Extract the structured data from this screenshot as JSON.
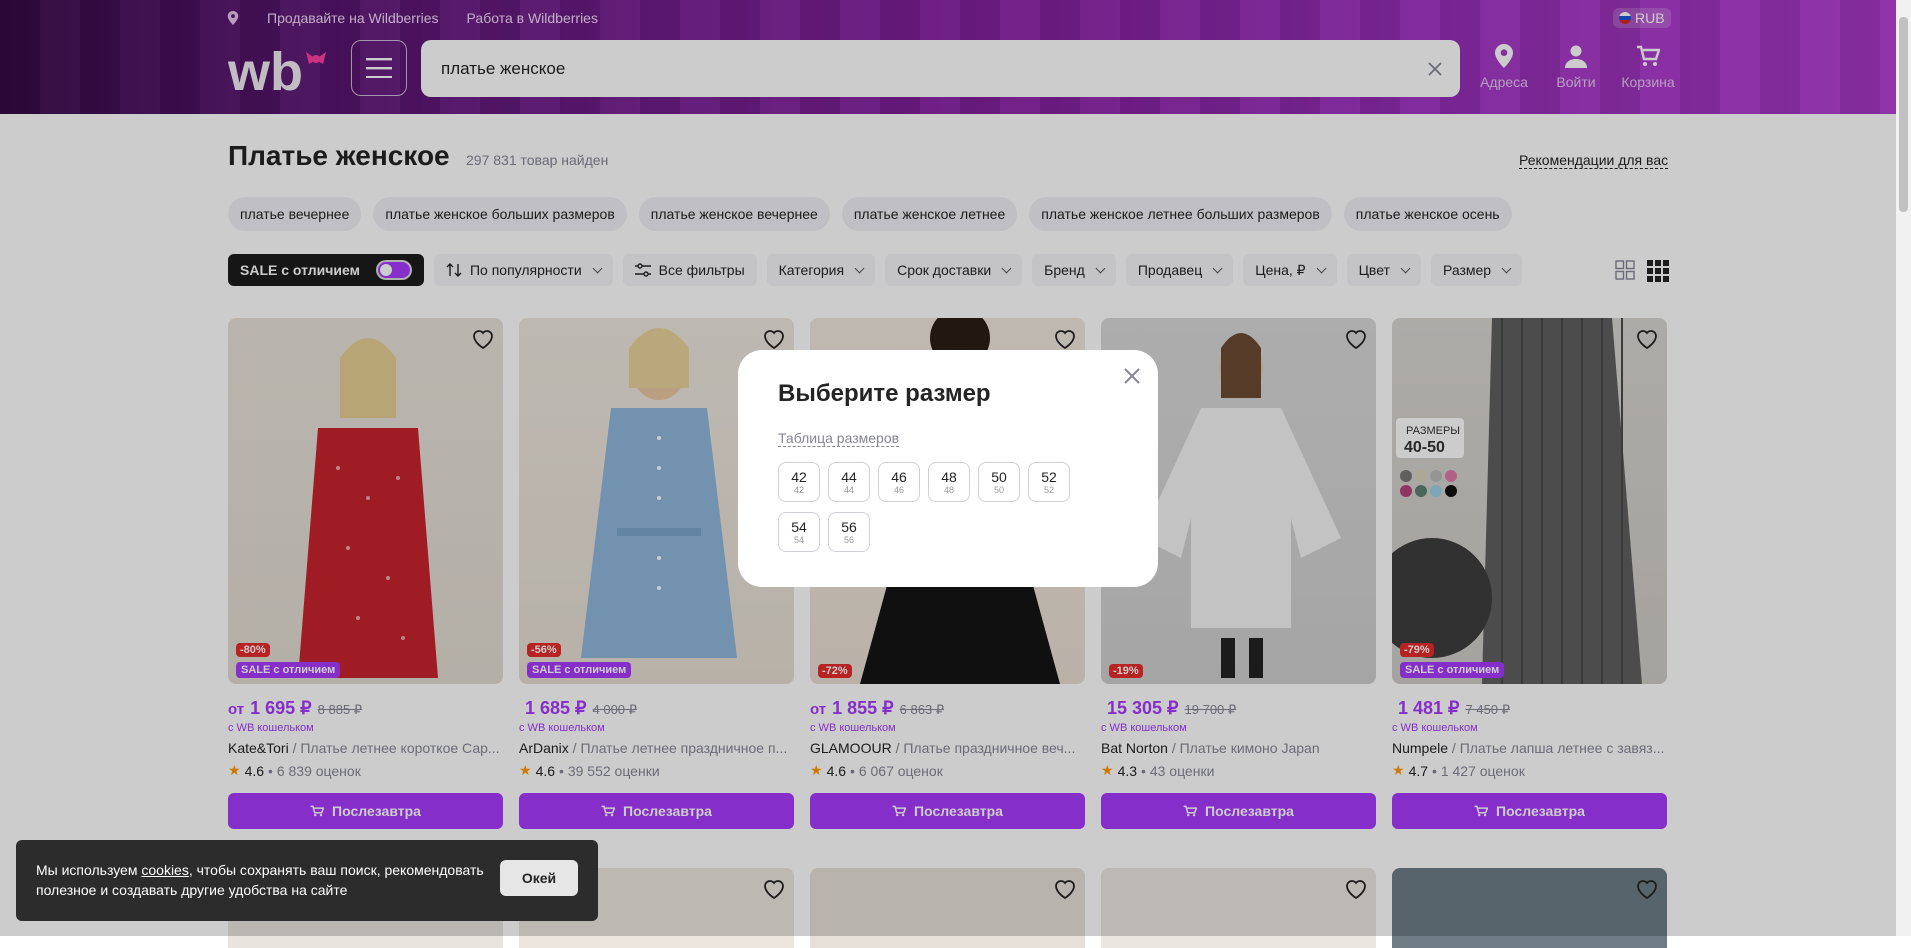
{
  "header": {
    "sell_link": "Продавайте на Wildberries",
    "work_link": "Работа в Wildberries",
    "currency": "RUB",
    "search_value": "платье женское",
    "icons": [
      {
        "icon": "location-pin-icon",
        "label": "Адреса"
      },
      {
        "icon": "user-icon",
        "label": "Войти"
      },
      {
        "icon": "cart-icon",
        "label": "Корзина"
      }
    ]
  },
  "page": {
    "title": "Платье женское",
    "count": "297 831 товар найден",
    "recommendations": "Рекомендации для вас"
  },
  "chips": [
    "платье вечернее",
    "платье женское больших размеров",
    "платье женское вечернее",
    "платье женское летнее",
    "платье женское летнее больших размеров",
    "платье женское осень"
  ],
  "filters": {
    "sale_toggle": "SALE с отличием",
    "sort": "По популярности",
    "all": "Все фильтры",
    "items": [
      "Категория",
      "Срок доставки",
      "Бренд",
      "Продавец",
      "Цена, ₽",
      "Цвет",
      "Размер"
    ]
  },
  "products": [
    {
      "from": "от",
      "price": "1 695 ₽",
      "old": "8 885 ₽",
      "wallet": "с WB кошельком",
      "brand": "Kate&Tori",
      "desc": " / Платье летнее короткое Сар...",
      "rating": "4.6",
      "reviews": "• 6 839 оценок",
      "discount": "-80%",
      "sale": "SALE с отличием",
      "buy": "Послезавтра"
    },
    {
      "from": "",
      "price": "1 685 ₽",
      "old": "4 000 ₽",
      "wallet": "с WB кошельком",
      "brand": "ArDanix",
      "desc": " / Платье летнее праздничное п...",
      "rating": "4.6",
      "reviews": "• 39 552 оценки",
      "discount": "-56%",
      "sale": "SALE с отличием",
      "buy": "Послезавтра"
    },
    {
      "from": "от",
      "price": "1 855 ₽",
      "old": "6 863 ₽",
      "wallet": "с WB кошельком",
      "brand": "GLAMOOUR",
      "desc": " / Платье праздничное веч...",
      "rating": "4.6",
      "reviews": "• 6 067 оценок",
      "discount": "-72%",
      "sale": "",
      "buy": "Послезавтра"
    },
    {
      "from": "",
      "price": "15 305 ₽",
      "old": "19 700 ₽",
      "wallet": "с WB кошельком",
      "brand": "Bat Norton",
      "desc": " / Платье кимоно Japan",
      "rating": "4.3",
      "reviews": "• 43 оценки",
      "discount": "-19%",
      "sale": "",
      "buy": "Послезавтра"
    },
    {
      "from": "",
      "price": "1 481 ₽",
      "old": "7 450 ₽",
      "wallet": "с WB кошельком",
      "brand": "Numpele",
      "desc": " / Платье лапша летнее с завяз...",
      "rating": "4.7",
      "reviews": "• 1 427 оценок",
      "discount": "-79%",
      "sale": "SALE с отличием",
      "buy": "Послезавтра"
    }
  ],
  "modal": {
    "title": "Выберите размер",
    "table_link": "Таблица размеров",
    "sizes": [
      {
        "main": "42",
        "sub": "42"
      },
      {
        "main": "44",
        "sub": "44"
      },
      {
        "main": "46",
        "sub": "46"
      },
      {
        "main": "48",
        "sub": "48"
      },
      {
        "main": "50",
        "sub": "50"
      },
      {
        "main": "52",
        "sub": "52"
      },
      {
        "main": "54",
        "sub": "54"
      },
      {
        "main": "56",
        "sub": "56"
      }
    ]
  },
  "cookie": {
    "pre": "Мы используем ",
    "link": "cookies",
    "post": ", чтобы сохранять ваш поиск, рекомендовать полезное и создавать другие удобства на сайте",
    "ok": "Окей"
  },
  "colors": {
    "accent": "#a73afd",
    "discount": "#e52b2b",
    "star": "#ff9800"
  }
}
